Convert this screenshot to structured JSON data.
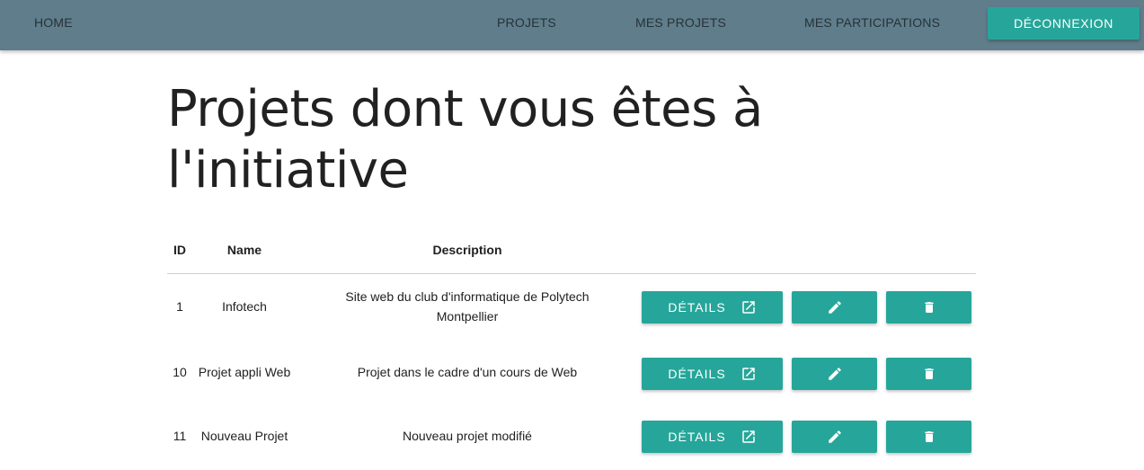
{
  "nav": {
    "home": "HOME",
    "projects": "PROJETS",
    "my_projects": "MES PROJETS",
    "my_participations": "MES PARTICIPATIONS",
    "logout": "DÉCONNEXION"
  },
  "page": {
    "title": "Projets dont vous êtes à l'initiative"
  },
  "table": {
    "headers": {
      "id": "ID",
      "name": "Name",
      "description": "Description"
    },
    "details_label": "DÉTAILS",
    "rows": [
      {
        "id": "1",
        "name": "Infotech",
        "description": "Site web du club d'informatique de Polytech Montpellier"
      },
      {
        "id": "10",
        "name": "Projet appli Web",
        "description": "Projet dans le cadre d'un cours de Web"
      },
      {
        "id": "11",
        "name": "Nouveau Projet",
        "description": "Nouveau projet modifié"
      }
    ]
  },
  "icons": {
    "details": "open-in-new-icon",
    "edit": "pencil-icon",
    "delete": "trash-icon"
  },
  "colors": {
    "navbar": "#607d8b",
    "accent": "#26a69a",
    "text": "#212121"
  }
}
